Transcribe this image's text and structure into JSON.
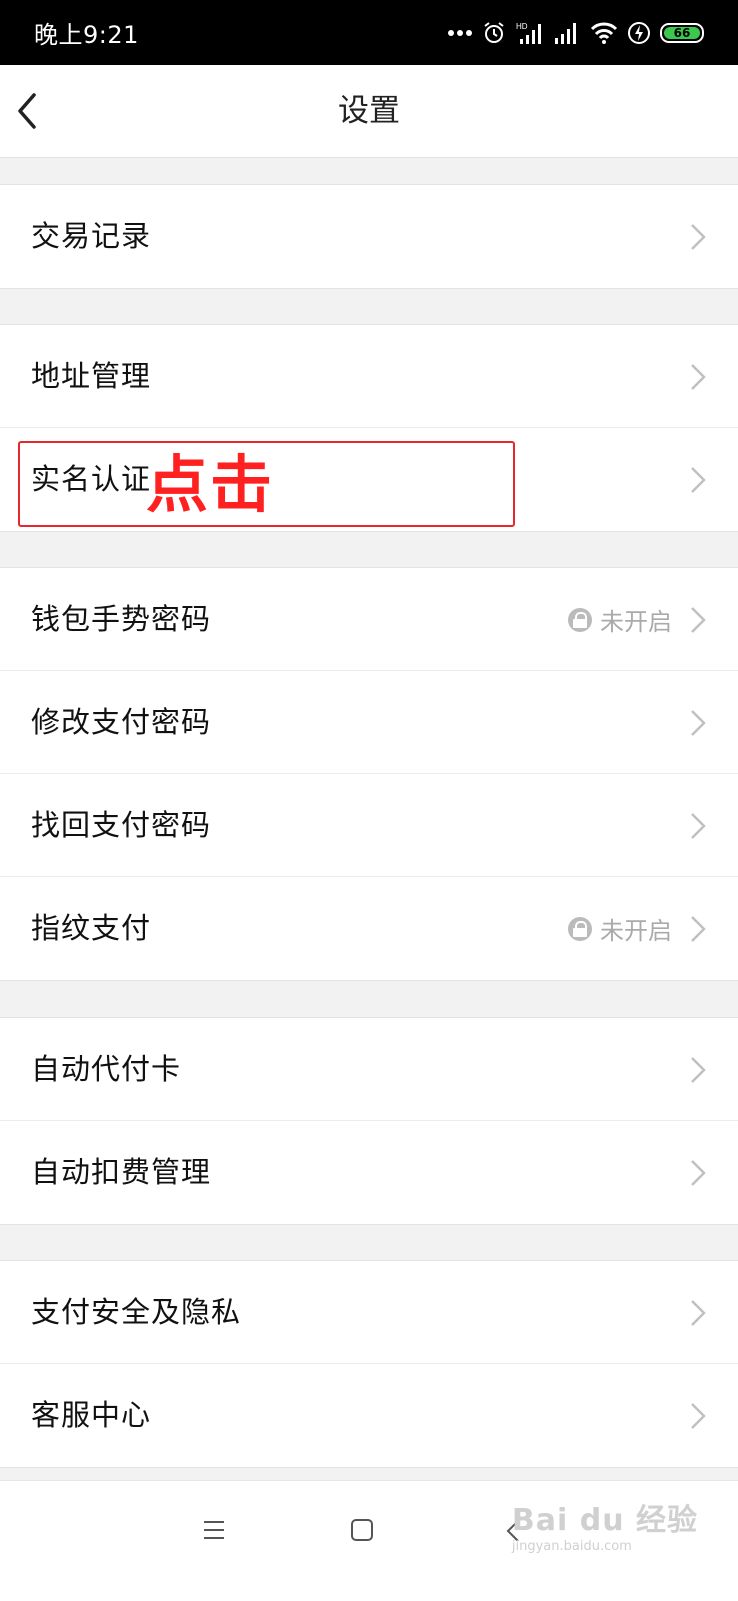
{
  "status_bar": {
    "time": "晚上9:21",
    "battery_level": "66",
    "icons": [
      "more-dots-icon",
      "alarm-icon",
      "hd-signal-icon",
      "signal-icon",
      "wifi-icon",
      "charging-icon",
      "battery-icon"
    ]
  },
  "header": {
    "title": "设置",
    "back_icon": "chevron-left-icon"
  },
  "groups": [
    {
      "items": [
        {
          "label": "交易记录"
        }
      ]
    },
    {
      "items": [
        {
          "label": "地址管理"
        },
        {
          "label": "实名认证"
        }
      ]
    },
    {
      "items": [
        {
          "label": "钱包手势密码",
          "status": "未开启"
        },
        {
          "label": "修改支付密码"
        },
        {
          "label": "找回支付密码"
        },
        {
          "label": "指纹支付",
          "status": "未开启"
        }
      ]
    },
    {
      "items": [
        {
          "label": "自动代付卡"
        },
        {
          "label": "自动扣费管理"
        }
      ]
    },
    {
      "items": [
        {
          "label": "支付安全及隐私"
        },
        {
          "label": "客服中心"
        }
      ]
    }
  ],
  "annotation": {
    "text": "点击",
    "color": "#ff2020"
  },
  "bottom_nav": {
    "icons": [
      "menu-icon",
      "home-square-icon",
      "back-icon"
    ]
  },
  "watermark": {
    "brand": "Bai du 经验",
    "url": "jingyan.baidu.com"
  }
}
